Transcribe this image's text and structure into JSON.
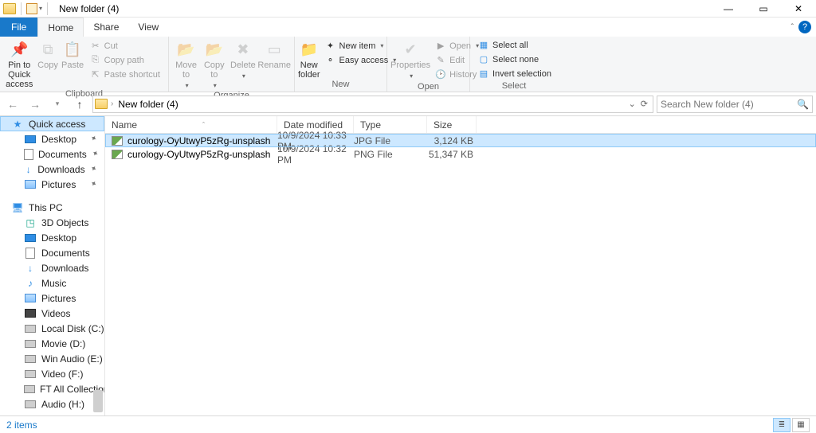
{
  "window": {
    "title": "New folder (4)"
  },
  "tabs": {
    "file": "File",
    "home": "Home",
    "share": "Share",
    "view": "View"
  },
  "ribbon": {
    "clipboard": {
      "label": "Clipboard",
      "pin": "Pin to Quick\naccess",
      "copy": "Copy",
      "paste": "Paste",
      "cut": "Cut",
      "copy_path": "Copy path",
      "paste_shortcut": "Paste shortcut"
    },
    "organize": {
      "label": "Organize",
      "move_to": "Move\nto",
      "copy_to": "Copy\nto",
      "delete": "Delete",
      "rename": "Rename"
    },
    "new": {
      "label": "New",
      "new_folder": "New\nfolder",
      "new_item": "New item",
      "easy_access": "Easy access"
    },
    "open": {
      "label": "Open",
      "properties": "Properties",
      "open": "Open",
      "edit": "Edit",
      "history": "History"
    },
    "select": {
      "label": "Select",
      "select_all": "Select all",
      "select_none": "Select none",
      "invert": "Invert selection"
    }
  },
  "address": {
    "crumb": "New folder (4)"
  },
  "search": {
    "placeholder": "Search New folder (4)"
  },
  "columns": {
    "name": "Name",
    "date": "Date modified",
    "type": "Type",
    "size": "Size"
  },
  "tree": {
    "quick_access": "Quick access",
    "desktop": "Desktop",
    "documents": "Documents",
    "downloads": "Downloads",
    "pictures": "Pictures",
    "this_pc": "This PC",
    "objects3d": "3D Objects",
    "music": "Music",
    "videos": "Videos",
    "local_disk": "Local Disk (C:)",
    "movie": "Movie (D:)",
    "win_audio": "Win Audio (E:)",
    "video_f": "Video (F:)",
    "ft_all": "FT All Collection",
    "audio_h": "Audio (H:)"
  },
  "files": [
    {
      "name": "curology-OyUtwyP5zRg-unsplash",
      "date": "10/9/2024 10:33 PM",
      "type": "JPG File",
      "size": "3,124 KB",
      "selected": true
    },
    {
      "name": "curology-OyUtwyP5zRg-unsplash",
      "date": "10/9/2024 10:32 PM",
      "type": "PNG File",
      "size": "51,347 KB",
      "selected": false
    }
  ],
  "status": {
    "items": "2 items"
  }
}
